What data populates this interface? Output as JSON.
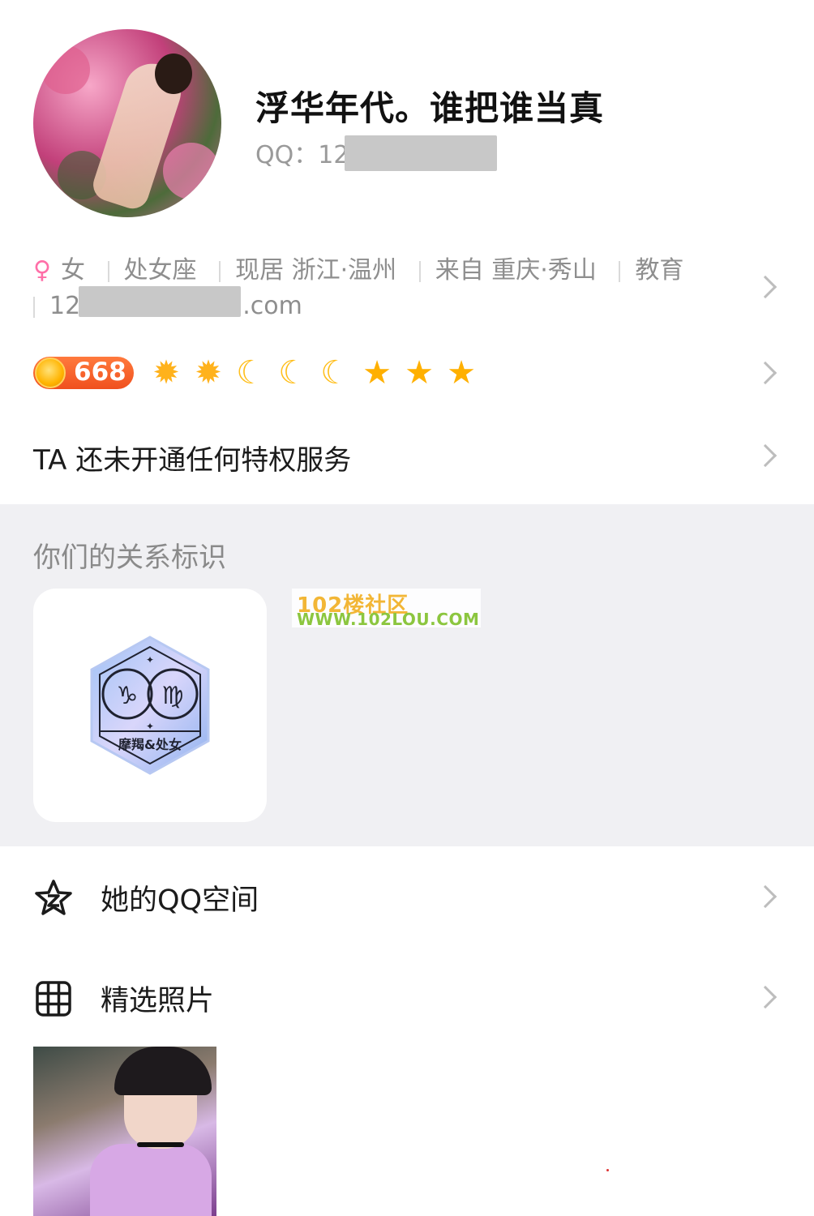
{
  "profile": {
    "nickname": "浮华年代。谁把谁当真",
    "qq_label": "QQ：12",
    "avatar_icon": "avatar-photo"
  },
  "info": {
    "gender": "女",
    "gender_icon": "female-icon",
    "zodiac": "处女座",
    "location": "现居 浙江·温州",
    "hometown": "来自 重庆·秀山",
    "occupation": "教育",
    "email_prefix": "12",
    "email_suffix": ".com"
  },
  "level": {
    "value": "668",
    "icons": [
      "sun",
      "sun",
      "moon",
      "moon",
      "moon",
      "star",
      "star",
      "star"
    ]
  },
  "privilege": {
    "text": "TA 还未开通任何特权服务"
  },
  "relation": {
    "title": "你们的关系标识",
    "badge_label": "摩羯&处女",
    "watermark_line1": "102楼社区",
    "watermark_line2": "WWW.102LOU.COM"
  },
  "list": {
    "qzone_label": "她的QQ空间",
    "photos_label": "精选照片"
  },
  "colors": {
    "accent_female": "#ff6fa8",
    "level_badge": "#f0501e",
    "section_bg": "#f0f0f3"
  }
}
